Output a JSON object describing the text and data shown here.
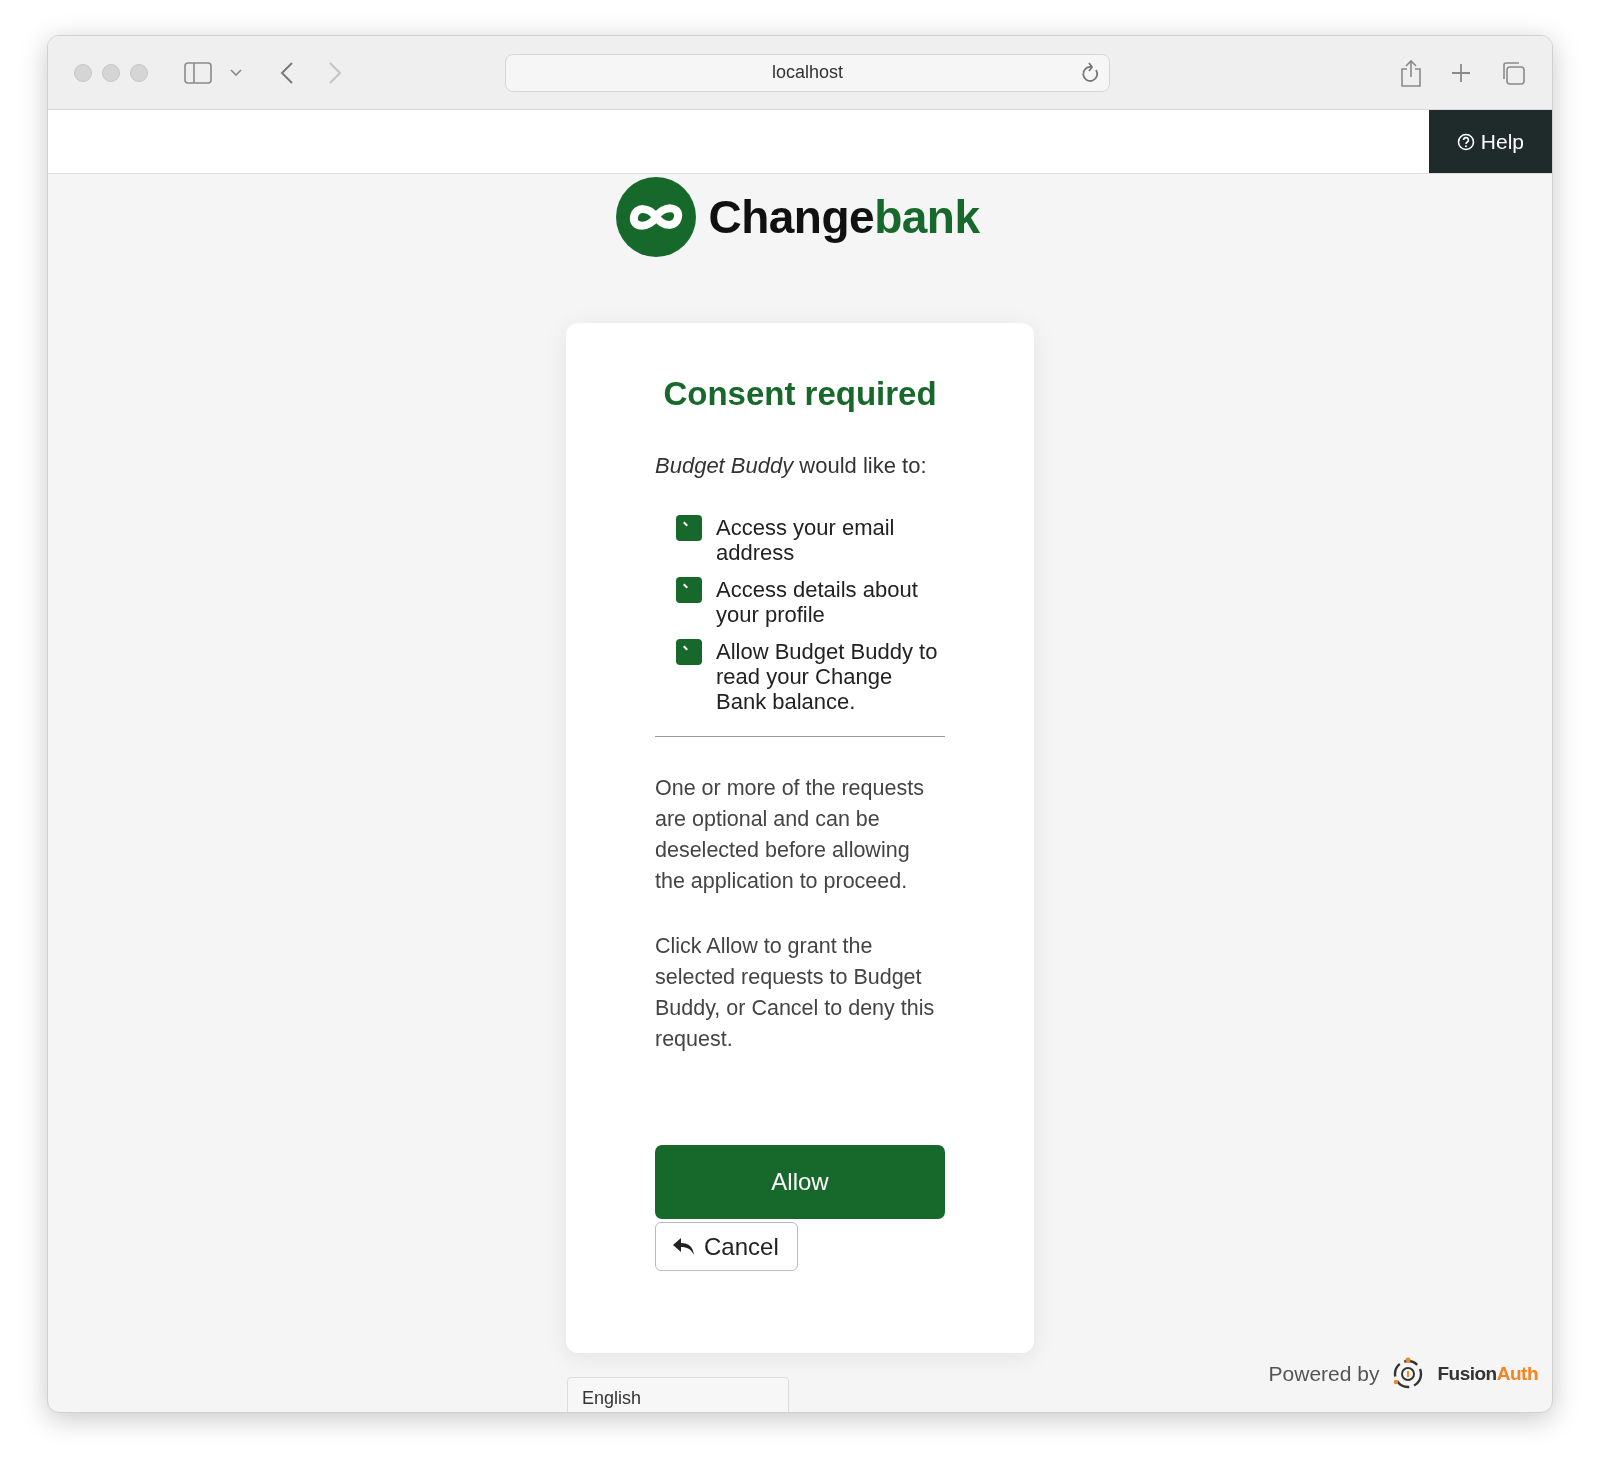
{
  "browser": {
    "url": "localhost"
  },
  "header": {
    "help_button": "Help"
  },
  "logo": {
    "part_1": "Change",
    "part_2": "bank"
  },
  "card": {
    "title": "Consent required",
    "intro": "*Budget Buddy* would like to:",
    "scopes": [
      {
        "label": "Access your email address",
        "checked": true
      },
      {
        "label": "Access details about your profile",
        "checked": true
      },
      {
        "label": "Allow Budget Buddy to read your Change Bank balance.",
        "checked": true
      }
    ],
    "paragraphs": [
      "One or more of the requests are optional and can be deselected before allowing the application to proceed.",
      "Click Allow to grant the selected requests to Budget Buddy, or Cancel to deny this request."
    ],
    "allow_button": "Allow",
    "cancel_button": "Cancel"
  },
  "footer": {
    "language": "English",
    "powered_by": "Powered by",
    "brand_part_1": "Fusion",
    "brand_part_2": "Auth"
  }
}
